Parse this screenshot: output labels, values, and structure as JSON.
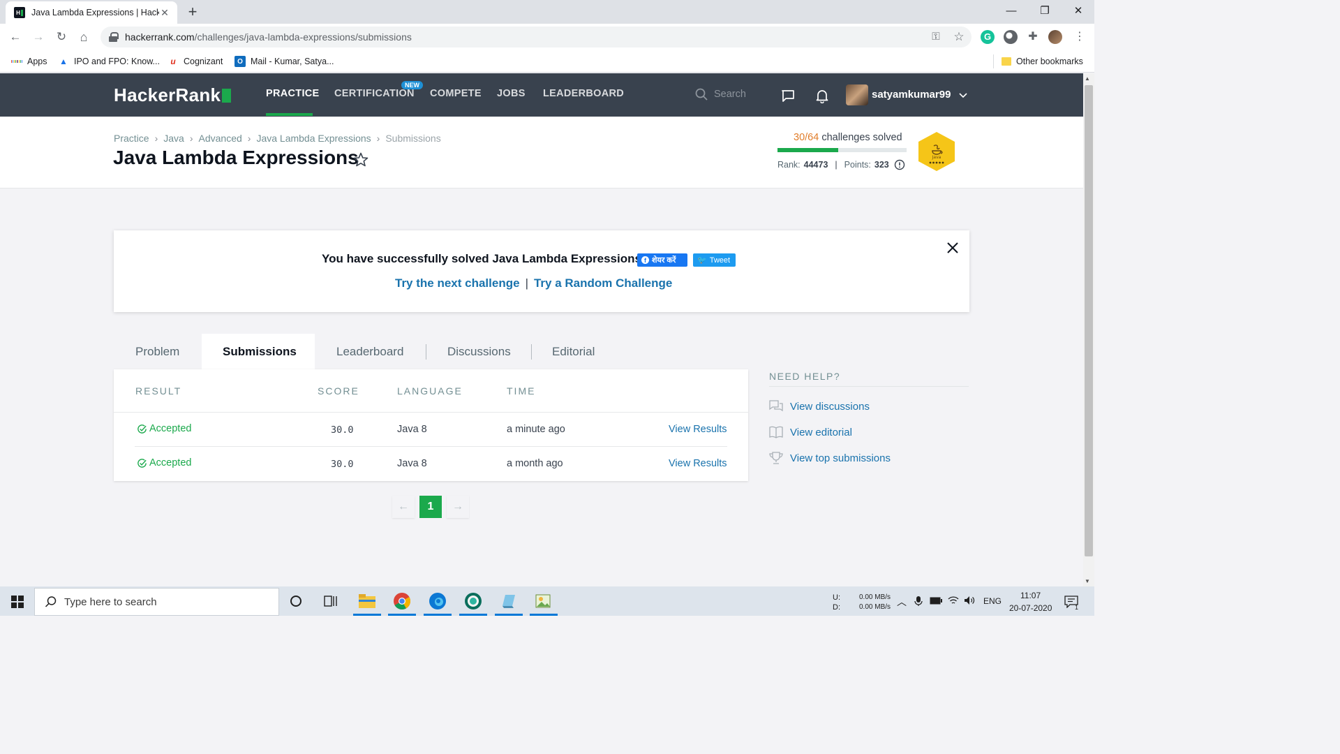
{
  "browser": {
    "tab_title": "Java Lambda Expressions | HackerRank",
    "url_host": "hackerrank.com",
    "url_path": "/challenges/java-lambda-expressions/submissions",
    "bookmarks": [
      {
        "label": "Apps"
      },
      {
        "label": "IPO and FPO: Know..."
      },
      {
        "label": "Cognizant"
      },
      {
        "label": "Mail - Kumar, Satya..."
      }
    ],
    "other_bookmarks": "Other bookmarks"
  },
  "navbar": {
    "logo": "HackerRank",
    "links": [
      "PRACTICE",
      "CERTIFICATION",
      "COMPETE",
      "JOBS",
      "LEADERBOARD"
    ],
    "new_badge": "NEW",
    "search_placeholder": "Search",
    "username": "satyamkumar99"
  },
  "header": {
    "breadcrumb": [
      "Practice",
      "Java",
      "Advanced",
      "Java Lambda Expressions",
      "Submissions"
    ],
    "title": "Java Lambda Expressions",
    "solved_count": "30/64",
    "solved_label": "challenges solved",
    "solved_fraction": 0.469,
    "rank_label": "Rank:",
    "rank_value": "44473",
    "points_label": "Points:",
    "points_value": "323",
    "badge_label": "Java"
  },
  "success": {
    "message": "You have successfully solved Java Lambda Expressions",
    "share_label": "शेयर करें",
    "tweet_label": "Tweet",
    "next_challenge": "Try the next challenge",
    "separator": "|",
    "random_challenge": "Try a Random Challenge"
  },
  "tabs": [
    "Problem",
    "Submissions",
    "Leaderboard",
    "Discussions",
    "Editorial"
  ],
  "submissions": {
    "headers": [
      "RESULT",
      "SCORE",
      "LANGUAGE",
      "TIME"
    ],
    "rows": [
      {
        "result": "Accepted",
        "score": "30.0",
        "language": "Java 8",
        "time": "a minute ago",
        "action": "View Results"
      },
      {
        "result": "Accepted",
        "score": "30.0",
        "language": "Java 8",
        "time": "a month ago",
        "action": "View Results"
      }
    ]
  },
  "pagination": {
    "prev": "←",
    "page": "1",
    "next": "→"
  },
  "help": {
    "title": "NEED HELP?",
    "links": [
      "View discussions",
      "View editorial",
      "View top submissions"
    ]
  },
  "taskbar": {
    "search_placeholder": "Type here to search",
    "net_up_label": "U:",
    "net_down_label": "D:",
    "net_up": "0.00 MB/s",
    "net_down": "0.00 MB/s",
    "language": "ENG",
    "time": "11:07",
    "date": "20-07-2020",
    "notifications": "1"
  },
  "colors": {
    "accent": "#1ba94c",
    "navbar": "#39424e",
    "link": "#1a73ad",
    "solved": "#e17d2a"
  }
}
